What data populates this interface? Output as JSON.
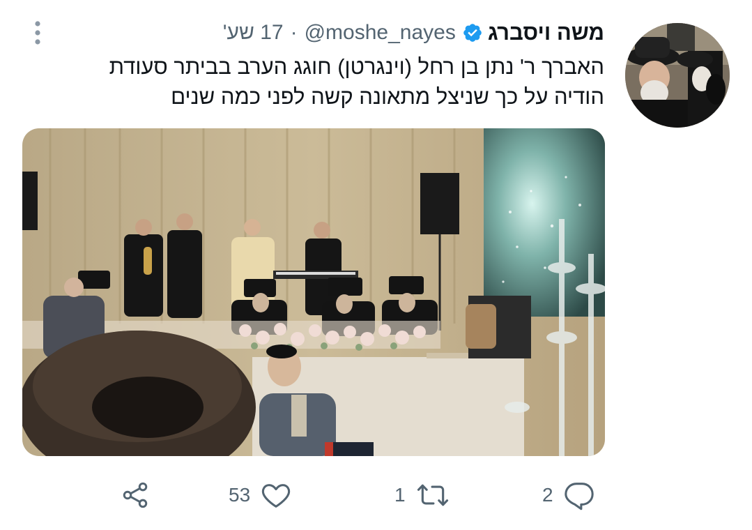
{
  "author": {
    "display_name": "משה ויסברג",
    "handle": "@moshe_nayes",
    "verified": true,
    "time_ago": "17 שע'"
  },
  "tweet": {
    "text": "האברך ר' נתן בן רחל (וינגרטן) חוגג הערב בביתר סעודת\nהודיה על כך שניצל מתאונה קשה לפני כמה שנים"
  },
  "actions": {
    "reply_count": "2",
    "retweet_count": "1",
    "like_count": "53"
  },
  "icons": {
    "more": "more-vertical-icon",
    "verified": "verified-badge-icon",
    "reply": "reply-icon",
    "retweet": "retweet-icon",
    "like": "heart-icon",
    "share": "share-icon"
  },
  "colors": {
    "text_primary": "#0f1419",
    "text_secondary": "#536471",
    "verified_blue": "#1d9bf0"
  }
}
